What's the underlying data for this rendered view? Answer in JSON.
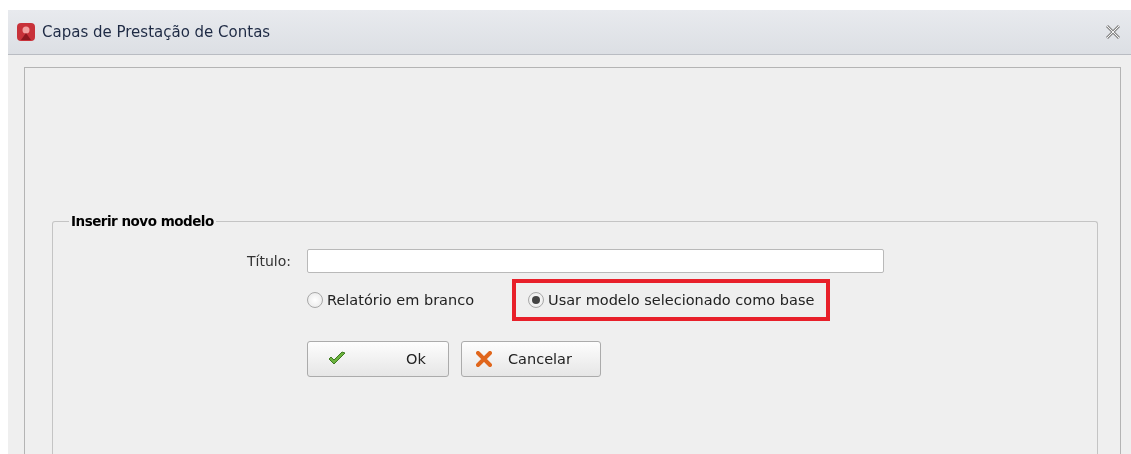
{
  "window": {
    "title": "Capas de Prestação de Contas"
  },
  "group": {
    "legend": "Inserir novo modelo"
  },
  "title_field": {
    "label": "Título:"
  },
  "options": [
    {
      "label": "Relatório em branco",
      "selected": false,
      "highlighted": false
    },
    {
      "label": "Usar modelo selecionado como base",
      "selected": true,
      "highlighted": true
    }
  ],
  "buttons": [
    {
      "label": "Ok",
      "kind": "ok"
    },
    {
      "label": "Cancelar",
      "kind": "cancel"
    }
  ]
}
